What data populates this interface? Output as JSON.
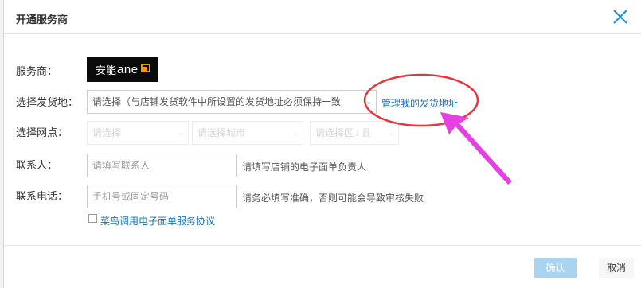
{
  "dialog": {
    "title": "开通服务商",
    "close_icon": "close-icon"
  },
  "form": {
    "provider_label": "服务商：",
    "provider_logo_text": "安能",
    "provider_logo_text2": "ane",
    "ship_from_label": "选择发货地：",
    "ship_from_value": "请选择（与店铺发货软件中所设置的发货地址必须保持一致",
    "manage_link": "管理我的发货地址",
    "network_label": "选择网点：",
    "network_province": "请选择",
    "network_city": "请选择城市",
    "network_district": "请选择区 / 县",
    "contact_label": "联系人：",
    "contact_placeholder": "请填写联系人",
    "contact_hint": "请填写店铺的电子面单负责人",
    "phone_label": "联系电话：",
    "phone_placeholder": "手机号或固定号码",
    "phone_hint": "请务必填写准确，否则可能会导致审核失败",
    "agreement_link": "菜鸟调用电子面单服务协议"
  },
  "footer": {
    "confirm_label": "确认",
    "cancel_label": "取消"
  },
  "colors": {
    "link": "#1d6fb8",
    "annotation": "#e8343c",
    "arrow": "#e83fe3"
  }
}
